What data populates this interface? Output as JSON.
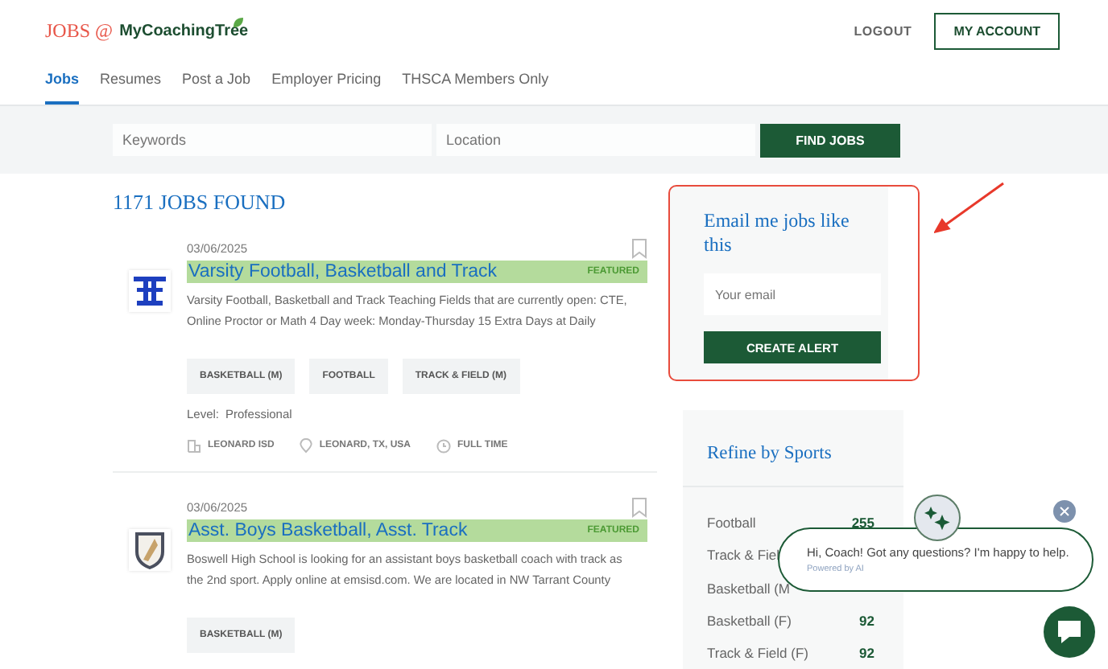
{
  "header": {
    "brand_jobs": "JOBS @",
    "brand_name": "MyCoachingTree",
    "logout": "LOGOUT",
    "account": "MY ACCOUNT"
  },
  "tabs": [
    {
      "label": "Jobs",
      "selected": true
    },
    {
      "label": "Resumes",
      "selected": false
    },
    {
      "label": "Post a Job",
      "selected": false
    },
    {
      "label": "Employer Pricing",
      "selected": false
    },
    {
      "label": "THSCA Members Only",
      "selected": false
    }
  ],
  "search": {
    "keywords_placeholder": "Keywords",
    "location_placeholder": "Location",
    "button": "FIND JOBS"
  },
  "results_heading": "1171 JOBS FOUND",
  "jobs": [
    {
      "kind": "crest",
      "date": "03/06/2025",
      "title": "Varsity Football, Basketball and Track",
      "featured": "FEATURED",
      "description": "Varsity Football, Basketball and Track Teaching Fields that are currently open: CTE, Online Proctor or Math 4 Day week: Monday-Thursday 15 Extra Days at Daily",
      "tags": [
        "BASKETBALL (M)",
        "FOOTBALL",
        "TRACK & FIELD (M)"
      ],
      "level_label": "Level:",
      "level": "Professional",
      "company": "LEONARD ISD",
      "location": "LEONARD, TX, USA",
      "job_type": "FULL TIME"
    },
    {
      "kind": "shield",
      "date": "03/06/2025",
      "title": "Asst. Boys Basketball, Asst. Track",
      "featured": "FEATURED",
      "description": "Boswell High School is looking for an assistant boys basketball coach with track as the 2nd sport.  Apply online at emsisd.com.  We are located in NW Tarrant County",
      "tags": [
        "BASKETBALL (M)"
      ]
    }
  ],
  "alert": {
    "title": "Email me jobs like this",
    "placeholder": "Your email",
    "button": "CREATE ALERT"
  },
  "refine": {
    "title": "Refine by Sports",
    "items": [
      {
        "name": "Football",
        "count": "255"
      },
      {
        "name": "Track & Fiel"
      },
      {
        "name": "Basketball (M"
      },
      {
        "name": "Basketball (F)",
        "count": "92"
      },
      {
        "name": "Track & Field (F)",
        "count": "92"
      }
    ]
  },
  "chat": {
    "message": "Hi, Coach! Got any questions? I'm happy to help.",
    "powered": "Powered by AI"
  }
}
